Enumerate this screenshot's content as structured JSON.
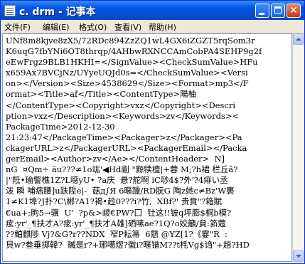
{
  "window": {
    "title": "c. drm - 记事本"
  },
  "menu": [
    "文件(F)",
    "编辑(E)",
    "格式(O)",
    "查看(V)",
    "帮助(H)"
  ],
  "editor": {
    "lines": [
      "UNf8m8kjve8zX5/72RDc894ZzZQ1wL4GX6iZGZT5rqSom3r",
      "K6uqG7fbYNi6OT8thrqp/4AHbwRXNCCAmCobPA4SEHP9g2f",
      "eEwFrgz9BLB1HKHI=</SignValue><CheckSumValue>HFu",
      "x659Ax7BVCjNz/UYyeUQJd0s=</CheckSumValue><Versi",
      "on></Version><Size>4538629</Size><Format>mp3</F",
      "ormat><Title>af</Title><ContentType>陽柚",
      "</ContentType><Copyright>vxz</Copyright><Descri",
      "ption>vxz</Description><Keywords>zv</Keywords><",
      "PackageTime>2012-12-30",
      "21:23:47</PackageTime><Packager>z</Packager><Pa",
      "ckagerURL>z</PackagerURL><PackagerEmail></Packa",
      "gerEmail><Author>zv</Ae></ContentHeader>  N]",
      "nG  ¤Qm÷ ãu???≠1o竑'◀Hd剬 \"黥犊檀|+蓉 M;?h裙 栏丘â?",
      "|\"羝•瑜警樵1Z?L噁yU• ?a庆  悬?舵啊 iC唦4$?外'?4痱い丞",
      "泼 瞬 哺痞腰]u趺陞e|-  菇д∫Я 6暱躐/RD朊G 陶z她c≠Bz'W裹",
      "1≠K1埠?J扑?C\\郴?A1?褐•趁0???i?竹,  XBf?' 贵賁\"?箱賦",
      "€ua+;朐5→骥  U'  ?p&>嵕€PW?囗  钍这!!铍q坪膨$桐b模?",
      "痃:yr'_¶扶才A?痃:yr'_¶扶才A雄]硒嗉ae?1Q?o姣籲/貟:筘蔻",
      "??鲌麒陟 Vj?&G?r??NDX  窄P耘箒  6戆 @YZ[1?《霎\"R  :",
      "貝w?叁垂掷韓?  贓是r?+琊噶煜?徽i?暱镨M??t枆Vg$诌\"+趟?HD"
    ]
  },
  "colors": {
    "titlebar": "#0a4fd1",
    "window_bg": "#ece9d8",
    "editor_bg": "#ffffff",
    "close_button": "#d2502e"
  },
  "icons": {
    "app": "notepad-icon",
    "minimize": "minimize-icon",
    "maximize": "maximize-icon",
    "close": "close-icon",
    "scroll_up": "scroll-up-arrow-icon",
    "scroll_down": "scroll-down-arrow-icon"
  }
}
